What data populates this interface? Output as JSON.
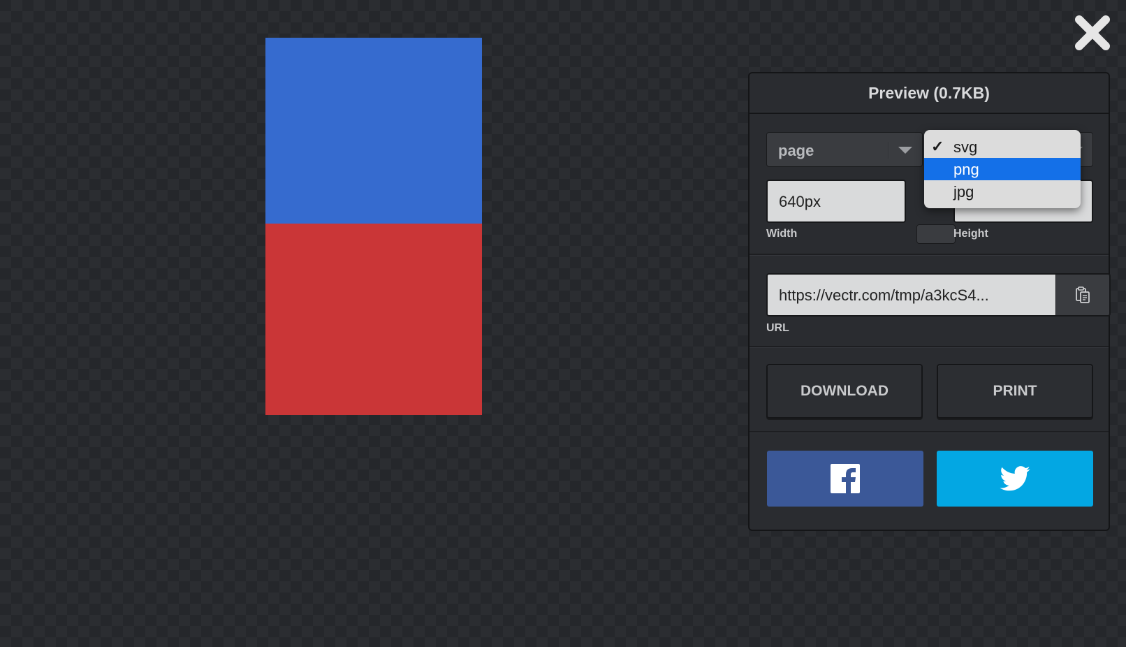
{
  "artwork": {
    "top_color": "#366bcf",
    "bottom_color": "#ca3637"
  },
  "panel": {
    "title": "Preview (0.7KB)",
    "scope_select": {
      "value": "page"
    },
    "format_select": {
      "options": [
        {
          "label": "svg",
          "checked": true,
          "highlighted": false
        },
        {
          "label": "png",
          "checked": false,
          "highlighted": true
        },
        {
          "label": "jpg",
          "checked": false,
          "highlighted": false
        }
      ]
    },
    "width": {
      "value": "640px",
      "label": "Width"
    },
    "height": {
      "value": "",
      "label": "Height"
    },
    "url": {
      "value": "https://vectr.com/tmp/a3kcS4...",
      "label": "URL"
    },
    "buttons": {
      "download": "DOWNLOAD",
      "print": "PRINT"
    },
    "social": {
      "facebook_color": "#3b5898",
      "twitter_color": "#03a7e3"
    },
    "highlight_color": "#1470e8"
  },
  "icons": {
    "close": "close-icon",
    "copy": "clipboard-icon",
    "facebook": "facebook-icon",
    "twitter": "twitter-icon"
  }
}
